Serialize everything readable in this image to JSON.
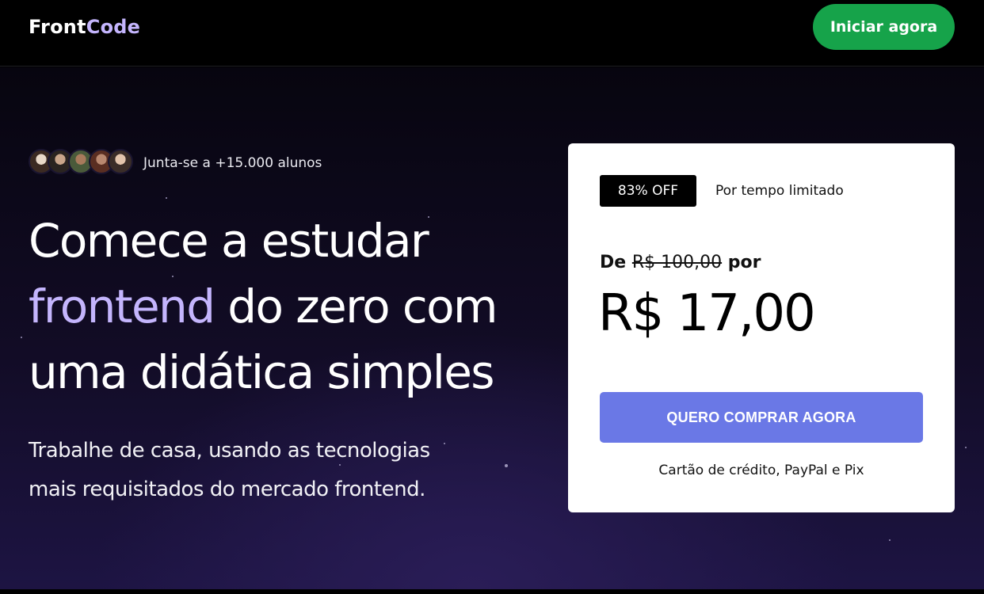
{
  "header": {
    "logo_part1": "Front",
    "logo_part2": "Code",
    "cta_label": "Iniciar agora"
  },
  "hero": {
    "students_text": "Junta-se a +15.000 alunos",
    "headline_line1": "Comece a estudar",
    "headline_highlight": "frontend",
    "headline_line2_rest": " do zero com",
    "headline_line3": "uma didática simples",
    "subtext_line1": "Trabalhe de casa, usando as tecnologias",
    "subtext_line2": "mais requisitados do mercado frontend."
  },
  "offer": {
    "discount_badge": "83% OFF",
    "limited_text": "Por tempo limitado",
    "from_prefix": "De",
    "old_price": "R$ 100,00",
    "from_suffix": "por",
    "new_price": "R$ 17,00",
    "buy_label": "QUERO COMPRAR AGORA",
    "payment_methods": "Cartão de crédito, PayPal e Pix"
  },
  "colors": {
    "accent_purple": "#c4b5fd",
    "green_cta": "#16a34a",
    "buy_button": "#6a78e6"
  }
}
